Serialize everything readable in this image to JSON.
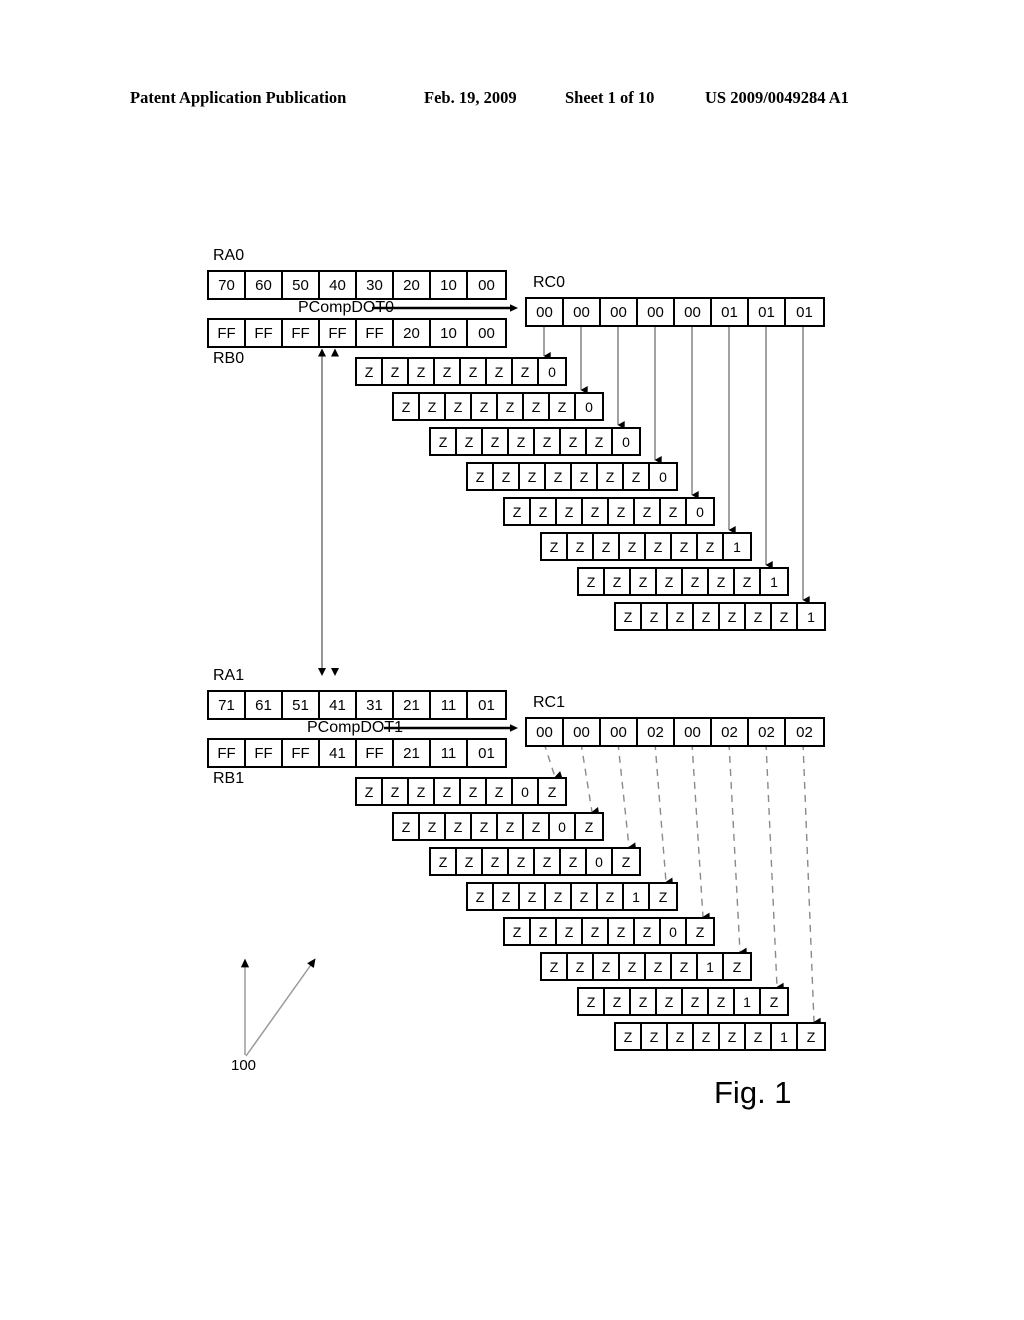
{
  "header": {
    "publication": "Patent Application Publication",
    "date": "Feb. 19, 2009",
    "sheet": "Sheet 1 of 10",
    "number": "US 2009/0049284 A1"
  },
  "figure": {
    "label": "Fig. 1",
    "ref_numeral": "100",
    "signal_labels": {
      "pcomp0": "PCompDOT0",
      "pcomp1": "PCompDOT1"
    },
    "colors": {
      "ink": "#000000",
      "paper": "#ffffff",
      "connector": "#808080"
    }
  },
  "group0": {
    "ra": {
      "name": "RA0",
      "cells": [
        "70",
        "60",
        "50",
        "40",
        "30",
        "20",
        "10",
        "00"
      ]
    },
    "rb": {
      "name": "RB0",
      "cells": [
        "FF",
        "FF",
        "FF",
        "FF",
        "FF",
        "20",
        "10",
        "00"
      ]
    },
    "rc": {
      "name": "RC0",
      "cells": [
        "00",
        "00",
        "00",
        "00",
        "00",
        "01",
        "01",
        "01"
      ]
    },
    "cascade": [
      {
        "cells": [
          "Z",
          "Z",
          "Z",
          "Z",
          "Z",
          "Z",
          "Z",
          "0"
        ]
      },
      {
        "cells": [
          "Z",
          "Z",
          "Z",
          "Z",
          "Z",
          "Z",
          "Z",
          "0"
        ]
      },
      {
        "cells": [
          "Z",
          "Z",
          "Z",
          "Z",
          "Z",
          "Z",
          "Z",
          "0"
        ]
      },
      {
        "cells": [
          "Z",
          "Z",
          "Z",
          "Z",
          "Z",
          "Z",
          "Z",
          "0"
        ]
      },
      {
        "cells": [
          "Z",
          "Z",
          "Z",
          "Z",
          "Z",
          "Z",
          "Z",
          "0"
        ]
      },
      {
        "cells": [
          "Z",
          "Z",
          "Z",
          "Z",
          "Z",
          "Z",
          "Z",
          "1"
        ]
      },
      {
        "cells": [
          "Z",
          "Z",
          "Z",
          "Z",
          "Z",
          "Z",
          "Z",
          "1"
        ]
      },
      {
        "cells": [
          "Z",
          "Z",
          "Z",
          "Z",
          "Z",
          "Z",
          "Z",
          "1"
        ]
      }
    ]
  },
  "group1": {
    "ra": {
      "name": "RA1",
      "cells": [
        "71",
        "61",
        "51",
        "41",
        "31",
        "21",
        "11",
        "01"
      ]
    },
    "rb": {
      "name": "RB1",
      "cells": [
        "FF",
        "FF",
        "FF",
        "41",
        "FF",
        "21",
        "11",
        "01"
      ]
    },
    "rc": {
      "name": "RC1",
      "cells": [
        "00",
        "00",
        "00",
        "02",
        "00",
        "02",
        "02",
        "02"
      ]
    },
    "cascade": [
      {
        "cells": [
          "Z",
          "Z",
          "Z",
          "Z",
          "Z",
          "Z",
          "0",
          "Z"
        ]
      },
      {
        "cells": [
          "Z",
          "Z",
          "Z",
          "Z",
          "Z",
          "Z",
          "0",
          "Z"
        ]
      },
      {
        "cells": [
          "Z",
          "Z",
          "Z",
          "Z",
          "Z",
          "Z",
          "0",
          "Z"
        ]
      },
      {
        "cells": [
          "Z",
          "Z",
          "Z",
          "Z",
          "Z",
          "Z",
          "1",
          "Z"
        ]
      },
      {
        "cells": [
          "Z",
          "Z",
          "Z",
          "Z",
          "Z",
          "Z",
          "0",
          "Z"
        ]
      },
      {
        "cells": [
          "Z",
          "Z",
          "Z",
          "Z",
          "Z",
          "Z",
          "1",
          "Z"
        ]
      },
      {
        "cells": [
          "Z",
          "Z",
          "Z",
          "Z",
          "Z",
          "Z",
          "1",
          "Z"
        ]
      },
      {
        "cells": [
          "Z",
          "Z",
          "Z",
          "Z",
          "Z",
          "Z",
          "1",
          "Z"
        ]
      }
    ]
  }
}
